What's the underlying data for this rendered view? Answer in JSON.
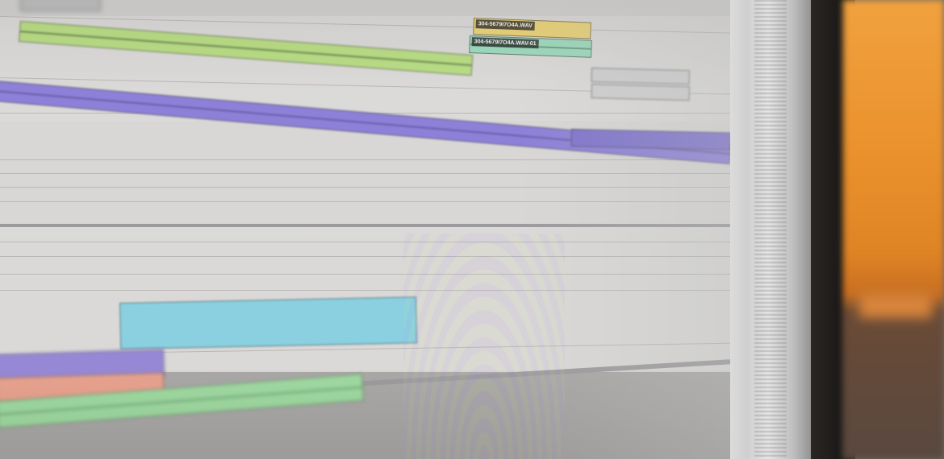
{
  "timeline": {
    "clips": [
      {
        "id": "top-gray-clip",
        "label": "",
        "color": "#bdbdbd"
      },
      {
        "id": "green-clip-top",
        "label": "",
        "color": "#b9dc86"
      },
      {
        "id": "yellow-clip",
        "label": "304-5679I7O4A.WAV",
        "color": "#e9d27a"
      },
      {
        "id": "teal-clip",
        "label": "304-5679I7O4A.WAV-01",
        "color": "#9ed9bd"
      },
      {
        "id": "gray-clip-a",
        "label": "",
        "color": "#cfcfcf"
      },
      {
        "id": "gray-clip-b",
        "label": "",
        "color": "#cfcfcf"
      },
      {
        "id": "purple-long-clip",
        "label": "",
        "color": "#8d80d8"
      },
      {
        "id": "purple-clip-end-label",
        "label": "",
        "color": "#7f74cc"
      },
      {
        "id": "cyan-clip",
        "label": "",
        "color": "#8ad0e0"
      },
      {
        "id": "purple-clip-low",
        "label": "",
        "color": "#9788d6"
      },
      {
        "id": "salmon-clip",
        "label": "",
        "color": "#e7a28e"
      },
      {
        "id": "green-clip-low",
        "label": "",
        "color": "#9fd9a0"
      }
    ]
  }
}
